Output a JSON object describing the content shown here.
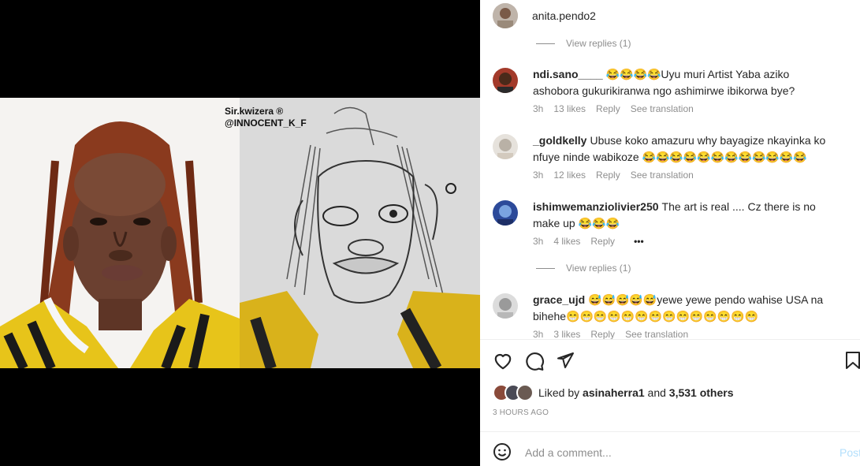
{
  "post": {
    "username": "anita.pendo2",
    "watermark_line1": "Sir.kwizera ®",
    "watermark_line2": "@INNOCENT_K_F"
  },
  "comments": {
    "view_replies_top": "View replies (1)",
    "items": [
      {
        "user": "ndi.sano____",
        "text": "😂😂😂😂Uyu muri Artist Yaba aziko ashobora gukurikiranwa ngo ashimirwe ibikorwa bye?",
        "time": "3h",
        "likes": "13 likes",
        "reply": "Reply",
        "translate": "See translation"
      },
      {
        "user": "_goldkelly",
        "text": "Ubuse koko amazuru why bayagize nkayinka ko nfuye ninde wabikoze 😂😂😂😂😂😂😂😂😂😂😂😂",
        "time": "3h",
        "likes": "12 likes",
        "reply": "Reply",
        "translate": "See translation"
      },
      {
        "user": "ishimwemanziolivier250",
        "text": "The art is real .... Cz there is no make up 😂😂😂",
        "time": "3h",
        "likes": "4 likes",
        "reply": "Reply",
        "more": "•••"
      },
      {
        "user": "grace_ujd",
        "text": "😅😅😅😅😅yewe yewe pendo wahise USA na bihehe😁😁😁😁😁😁😁😁😁😁😁😁😁😁",
        "time": "3h",
        "likes": "3 likes",
        "reply": "Reply",
        "translate": "See translation"
      }
    ],
    "view_replies_bottom": "View replies (1)"
  },
  "likes": {
    "prefix": "Liked by ",
    "user": "asinaherra1",
    "middle": " and ",
    "count": "3,531 others"
  },
  "timestamp": "3 HOURS AGO",
  "add_comment": {
    "placeholder": "Add a comment...",
    "post_label": "Post"
  },
  "icons": {
    "like": "heart-icon",
    "comment": "comment-bubble-icon",
    "share": "paper-plane-icon",
    "save": "bookmark-icon",
    "emoji": "smiley-icon"
  },
  "colors": {
    "muted": "#8e8e8e",
    "post_disabled": "#b2dffc",
    "text": "#262626"
  }
}
